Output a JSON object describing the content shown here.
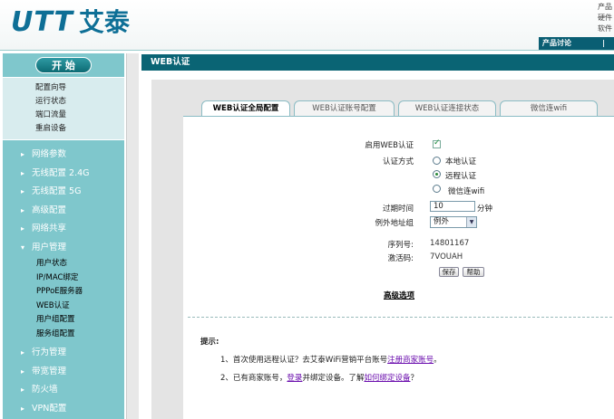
{
  "header": {
    "logo_text": "UTT",
    "logo_cn": "艾泰",
    "top_right_lines": [
      "产品",
      "硬件",
      "软件"
    ],
    "product_link": "产品讨论",
    "product_sep": "|"
  },
  "sidebar": {
    "start_label": "开 始",
    "quick_items": [
      "配置向导",
      "运行状态",
      "端口流量",
      "重启设备"
    ],
    "menu_before": [
      {
        "label": "网络参数",
        "arrow": "▸"
      },
      {
        "label": "无线配置 2.4G",
        "arrow": "▸"
      },
      {
        "label": "无线配置 5G",
        "arrow": "▸"
      },
      {
        "label": "高级配置",
        "arrow": "▸"
      },
      {
        "label": "网络共享",
        "arrow": "▸"
      },
      {
        "label": "用户管理",
        "arrow": "▾"
      }
    ],
    "sub_items": [
      "用户状态",
      "IP/MAC绑定",
      "PPPoE服务器",
      "WEB认证",
      "用户组配置",
      "服务组配置"
    ],
    "menu_after": [
      {
        "label": "行为管理",
        "arrow": "▸"
      },
      {
        "label": "带宽管理",
        "arrow": "▸"
      },
      {
        "label": "防火墙",
        "arrow": "▸"
      },
      {
        "label": "VPN配置",
        "arrow": "▸"
      }
    ]
  },
  "main": {
    "title": "WEB认证",
    "tabs": [
      "WEB认证全局配置",
      "WEB认证账号配置",
      "WEB认证连接状态",
      "微信连wifi"
    ],
    "form": {
      "enable_label": "启用WEB认证",
      "auth_method_label": "认证方式",
      "auth_options": [
        "本地认证",
        "远程认证",
        "微信连wifi"
      ],
      "expire_label": "过期时间",
      "expire_value": "10",
      "expire_unit": "分钟",
      "exception_label": "例外地址组",
      "exception_value": "例外",
      "serial_label": "序列号:",
      "serial_value": "14801167",
      "activation_label": "激活码:",
      "activation_value": "7VOUAH",
      "save_button": "保存",
      "help_button": "帮助",
      "advanced_link": "高级选项"
    },
    "tips": {
      "title": "提示:",
      "tip1_prefix": "1、首次使用远程认证？去艾泰WiFi营销平台账号",
      "tip1_link": "注册商家账号",
      "tip1_suffix": "。",
      "tip2_prefix": "2、已有商家账号，",
      "tip2_link1": "登录",
      "tip2_mid": "并绑定设备。了解",
      "tip2_link2": "如何绑定设备",
      "tip2_suffix": "？"
    }
  },
  "colors": {
    "brand": "#0e6f96",
    "title_bar": "#0a6474",
    "sidebar_bg": "#7fc7cc",
    "link": "#6a0dad"
  }
}
